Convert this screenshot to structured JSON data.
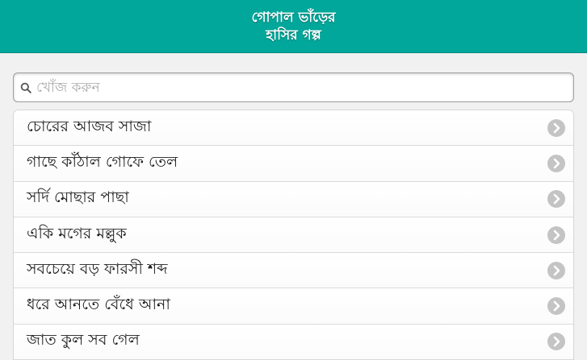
{
  "header": {
    "title_line1": "গোপাল ভাঁড়ের",
    "title_line2": "হাসির গল্প"
  },
  "search": {
    "placeholder": "খোঁজ করুন",
    "value": "",
    "icon": "search-icon"
  },
  "list": {
    "items": [
      {
        "label": "চোরের আজব সাজা"
      },
      {
        "label": "গাছে কাঁঠাল গোফে তেল"
      },
      {
        "label": "সর্দি মোছার পাছা"
      },
      {
        "label": "একি মগের মল্লুক"
      },
      {
        "label": "সবচেয়ে বড় ফারসী শব্দ"
      },
      {
        "label": "ধরে আনতে বেঁধে আনা"
      },
      {
        "label": "জাত কুল সব গেল"
      }
    ],
    "item_icon": "chevron-right-icon"
  },
  "colors": {
    "header_bg": "#00a79a",
    "page_bg": "#f1f1f1",
    "chevron": "#c4c4c4"
  }
}
